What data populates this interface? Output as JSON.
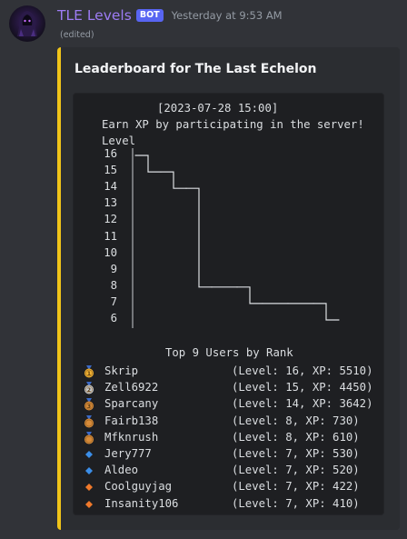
{
  "message": {
    "author": "TLE Levels",
    "bot_tag": "BOT",
    "timestamp": "Yesterday at 9:53 AM",
    "edited": "(edited)"
  },
  "embed": {
    "title": "Leaderboard for The Last Echelon",
    "accent_color": "#f0c419",
    "code": {
      "datetime": "[2023-07-28 15:00]",
      "subtitle": "Earn XP by participating in the server!",
      "axis_label": "Level",
      "section_title": "Top 9 Users by Rank"
    }
  },
  "chart_data": {
    "type": "line",
    "title": "",
    "ylabel": "Level",
    "xlabel": "",
    "ylim": [
      6,
      16
    ],
    "y_ticks": [
      "16",
      "15",
      "14",
      "13",
      "12",
      "11",
      "10",
      "9",
      "8",
      "7",
      "6"
    ],
    "categories": [
      "Skrip",
      "Zell6922",
      "Sparcany",
      "Fairb138",
      "Mfknrush",
      "Jery777",
      "Aldeo",
      "Coolguyjag",
      "Insanity106"
    ],
    "values": [
      16,
      15,
      14,
      8,
      8,
      7,
      7,
      7,
      6
    ]
  },
  "leaderboard": [
    {
      "icon": "gold-medal-icon",
      "name": "Skrip",
      "stats": "(Level: 16, XP: 5510)"
    },
    {
      "icon": "silver-medal-icon",
      "name": "Zell6922",
      "stats": "(Level: 15, XP: 4450)"
    },
    {
      "icon": "bronze-medal-icon",
      "name": "Sparcany",
      "stats": "(Level: 14, XP: 3642)"
    },
    {
      "icon": "medal-icon",
      "name": "Fairb138",
      "stats": "(Level: 8, XP: 730)"
    },
    {
      "icon": "medal-icon",
      "name": "Mfknrush",
      "stats": "(Level: 8, XP: 610)"
    },
    {
      "icon": "blue-diamond-icon",
      "name": "Jery777",
      "stats": "(Level: 7, XP: 530)"
    },
    {
      "icon": "blue-diamond-icon",
      "name": "Aldeo",
      "stats": "(Level: 7, XP: 520)"
    },
    {
      "icon": "orange-diamond-icon",
      "name": "Coolguyjag",
      "stats": "(Level: 7, XP: 422)"
    },
    {
      "icon": "orange-diamond-icon",
      "name": "Insanity106",
      "stats": "(Level: 7, XP: 410)"
    }
  ],
  "colors": {
    "gold": "#f0b232",
    "silver": "#c7cdd3",
    "bronze": "#d78b3a",
    "blue": "#3b8ee8",
    "orange": "#f0792b"
  }
}
